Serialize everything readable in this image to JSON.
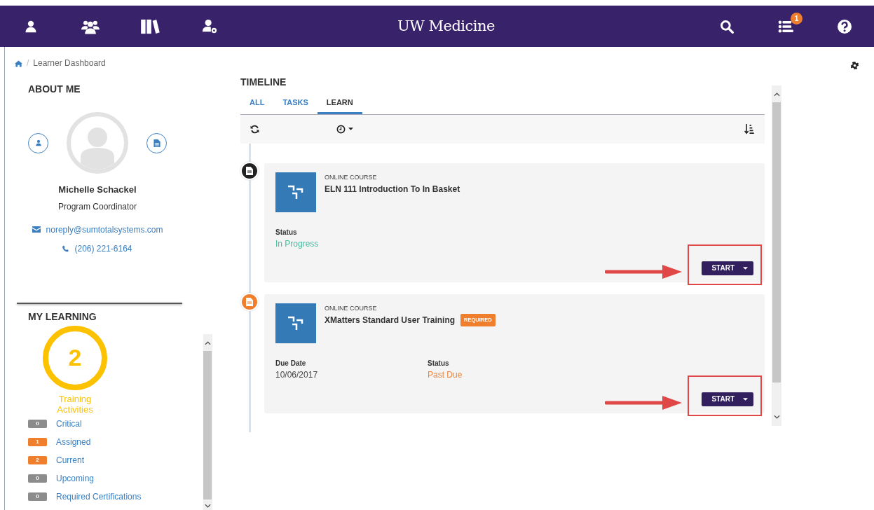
{
  "navbar": {
    "brand": "UW Medicine",
    "tasks_badge": "1"
  },
  "breadcrumb": {
    "separator": "/",
    "current": "Learner Dashboard"
  },
  "about_me": {
    "title": "ABOUT ME",
    "name": "Michelle Schackel",
    "role": "Program Coordinator",
    "email": "noreply@sumtotalsystems.com",
    "phone": "(206) 221-6164"
  },
  "my_learning": {
    "title": "MY LEARNING",
    "count": "2",
    "count_label": "Training Activities",
    "items": [
      {
        "count": "0",
        "label": "Critical",
        "color": "#8c8c8c"
      },
      {
        "count": "1",
        "label": "Assigned",
        "color": "#f07f2d"
      },
      {
        "count": "2",
        "label": "Current",
        "color": "#f07f2d"
      },
      {
        "count": "0",
        "label": "Upcoming",
        "color": "#8c8c8c"
      },
      {
        "count": "0",
        "label": "Required Certifications",
        "color": "#8c8c8c"
      }
    ]
  },
  "timeline": {
    "title": "TIMELINE",
    "tabs": [
      {
        "label": "ALL",
        "selected": false
      },
      {
        "label": "TASKS",
        "selected": false
      },
      {
        "label": "LEARN",
        "selected": true
      }
    ],
    "items": [
      {
        "kind": "standard",
        "type": "ONLINE COURSE",
        "title": "ELN 111 Introduction To In Basket",
        "fields": [
          {
            "label": "Status",
            "value": "In Progress",
            "color": "#3dbf9c"
          }
        ],
        "button": "START",
        "highlighted": true
      },
      {
        "kind": "required",
        "type": "ONLINE COURSE",
        "title": "XMatters Standard User Training",
        "badge": "REQUIRED",
        "fields": [
          {
            "label": "Due Date",
            "value": "10/06/2017",
            "color": "#444444"
          },
          {
            "label": "Status",
            "value": "Past Due",
            "color": "#f0843c"
          }
        ],
        "button": "START",
        "highlighted": true
      }
    ]
  }
}
